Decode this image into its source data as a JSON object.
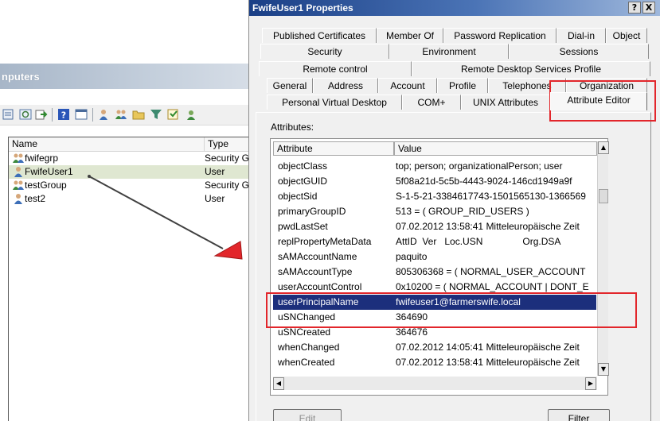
{
  "background_window": {
    "title": "nputers",
    "columns": [
      "Name",
      "Type"
    ],
    "rows": [
      {
        "name": "fwifegrp",
        "type": "Security G",
        "icon": "group-icon",
        "selected": false
      },
      {
        "name": "FwifeUser1",
        "type": "User",
        "icon": "user-icon",
        "selected": true
      },
      {
        "name": "testGroup",
        "type": "Security G",
        "icon": "group-icon",
        "selected": false
      },
      {
        "name": "test2",
        "type": "User",
        "icon": "user-icon",
        "selected": false
      }
    ]
  },
  "dialog": {
    "title": "FwifeUser1 Properties",
    "help_label": "?",
    "close_label": "X",
    "tabs_row1": [
      "Published Certificates",
      "Member Of",
      "Password Replication",
      "Dial-in",
      "Object"
    ],
    "tabs_row2": [
      "Security",
      "Environment",
      "Sessions"
    ],
    "tabs_row3": [
      "Remote control",
      "Remote Desktop Services Profile"
    ],
    "tabs_row4": [
      "General",
      "Address",
      "Account",
      "Profile",
      "Telephones",
      "Organization"
    ],
    "tabs_row5": [
      "Personal Virtual Desktop",
      "COM+",
      "UNIX Attributes",
      "Attribute Editor"
    ],
    "active_tab": "Attribute Editor",
    "attributes_label": "Attributes:",
    "grid_headers": {
      "attribute": "Attribute",
      "value": "Value"
    },
    "attributes": [
      {
        "name": "objectClass",
        "value": "top; person; organizationalPerson; user"
      },
      {
        "name": "objectGUID",
        "value": "5f08a21d-5c5b-4443-9024-146cd1949a9f"
      },
      {
        "name": "objectSid",
        "value": "S-1-5-21-3384617743-1501565130-1366569"
      },
      {
        "name": "primaryGroupID",
        "value": "513 = ( GROUP_RID_USERS )"
      },
      {
        "name": "pwdLastSet",
        "value": "07.02.2012 13:58:41 Mitteleuropäische Zeit"
      },
      {
        "name": "replPropertyMetaData",
        "value": "AttID  Ver   Loc.USN               Org.DSA"
      },
      {
        "name": "sAMAccountName",
        "value": "paquito"
      },
      {
        "name": "sAMAccountType",
        "value": "805306368 = ( NORMAL_USER_ACCOUNT"
      },
      {
        "name": "userAccountControl",
        "value": "0x10200 = ( NORMAL_ACCOUNT | DONT_E"
      },
      {
        "name": "userPrincipalName",
        "value": "fwifeuser1@farmerswife.local"
      },
      {
        "name": "uSNChanged",
        "value": "364690"
      },
      {
        "name": "uSNCreated",
        "value": "364676"
      },
      {
        "name": "whenChanged",
        "value": "07.02.2012 14:05:41 Mitteleuropäische Zeit"
      },
      {
        "name": "whenCreated",
        "value": "07.02.2012 13:58:41 Mitteleuropäische Zeit"
      }
    ],
    "selected_attribute": "userPrincipalName",
    "edit_label": "Edit",
    "filter_label": "Filter"
  },
  "colors": {
    "highlight": "#e2262b",
    "selection": "#1c2f7c",
    "title_bar": "#1a3f86"
  }
}
